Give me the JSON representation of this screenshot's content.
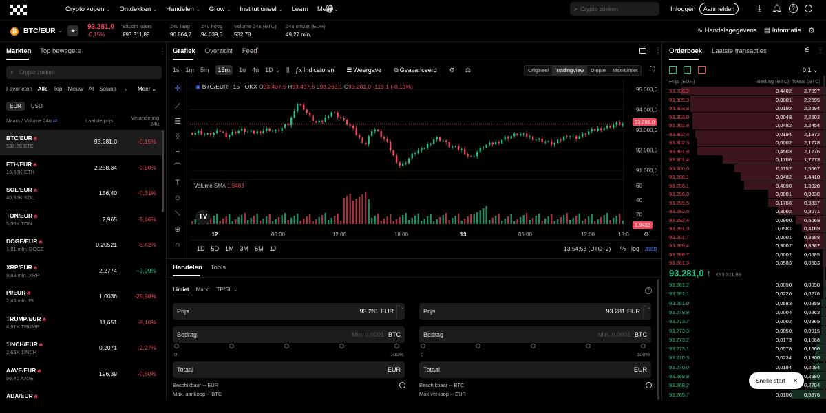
{
  "nav": {
    "items": [
      "Crypto kopen",
      "Ontdekken",
      "Handelen",
      "Grow",
      "Institutioneel",
      "Learn",
      "Meer"
    ],
    "search_placeholder": "Crypto zoeken",
    "login": "Inloggen",
    "signup": "Aanmelden"
  },
  "ticker": {
    "pair": "BTC/EUR",
    "last_price": "93.281,0",
    "change": "-0,15%",
    "stats": [
      {
        "label": "Bitcoin koers",
        "value": "€93.311,89"
      },
      {
        "label": "24u laag",
        "value": "90.864,7"
      },
      {
        "label": "24u hoog",
        "value": "94.039,8"
      },
      {
        "label": "Volume 24u (BTC)",
        "value": "532,78"
      },
      {
        "label": "24u omzet (EUR)",
        "value": "49,27 mln."
      }
    ],
    "trade_data": "Handelsgegevens",
    "info": "Informatie"
  },
  "markets": {
    "tabs": [
      "Markten",
      "Top bewegers"
    ],
    "search_placeholder": "Crypto zoeken",
    "filters": [
      "Favorieten",
      "Alle",
      "Top",
      "Nieuw",
      "AI",
      "Solana"
    ],
    "more": "Meer",
    "currencies": [
      "EUR",
      "USD"
    ],
    "col_name": "Naam / Volume 24u",
    "col_price": "Laatste prijs",
    "col_change": "Verandering 24u",
    "rows": [
      {
        "pair": "BTC/EUR",
        "vol": "532,78 BTC",
        "price": "93.281,0",
        "change": "-0,15%",
        "up": false
      },
      {
        "pair": "ETH/EUR",
        "vol": "16,66K ETH",
        "price": "2.258,34",
        "change": "-0,90%",
        "up": false
      },
      {
        "pair": "SOL/EUR",
        "vol": "40,35K SOL",
        "price": "156,40",
        "change": "-0,31%",
        "up": false
      },
      {
        "pair": "TON/EUR",
        "vol": "5,06K TON",
        "price": "2,965",
        "change": "-5,66%",
        "up": false
      },
      {
        "pair": "DOGE/EUR",
        "vol": "1,81 mln. DOGE",
        "price": "0,20521",
        "change": "-6,42%",
        "up": false
      },
      {
        "pair": "XRP/EUR",
        "vol": "9,83 mln. XRP",
        "price": "2,2774",
        "change": "+3,09%",
        "up": true
      },
      {
        "pair": "PI/EUR",
        "vol": "2,43 mln. PI",
        "price": "1,0036",
        "change": "-25,98%",
        "up": false
      },
      {
        "pair": "TRUMP/EUR",
        "vol": "4,91K TRUMP",
        "price": "11,651",
        "change": "-8,10%",
        "up": false
      },
      {
        "pair": "1INCH/EUR",
        "vol": "2,63K 1INCH",
        "price": "0,2071",
        "change": "-2,27%",
        "up": false
      },
      {
        "pair": "AAVE/EUR",
        "vol": "96,40 AAVE",
        "price": "196,39",
        "change": "-0,50%",
        "up": false
      },
      {
        "pair": "ADA/EUR",
        "vol": "",
        "price": "",
        "change": "",
        "up": false
      }
    ]
  },
  "chart": {
    "tabs": [
      "Grafiek",
      "Overzicht",
      "Feed"
    ],
    "timeframes": [
      "1s",
      "1m",
      "5m",
      "15m",
      "1u",
      "4u",
      "1D"
    ],
    "active_tf": "15m",
    "tools": [
      "Indicatoren",
      "Weergave",
      "Geavanceerd"
    ],
    "views": [
      "Origineel",
      "TradingView",
      "Diepte",
      "Marktlimiet"
    ],
    "active_view": "TradingView",
    "legend_pair": "BTC/EUR · 15 · OKX",
    "ohlc": {
      "O": "93.407,5",
      "H": "93.407,5",
      "L": "93.263,1",
      "C": "93.281,0",
      "chg": "-119,1 (-0,13%)"
    },
    "volume_label": "Volume",
    "sma_label": "SMA",
    "sma_value": "1,9483",
    "price_tag": "93.281,0",
    "vol_tag": "1,9483",
    "ranges": [
      "1D",
      "5D",
      "1M",
      "3M",
      "6M",
      "1J"
    ],
    "clock": "13:54:53 (UTC+2)",
    "scale_opts": [
      "%",
      "log",
      "auto"
    ]
  },
  "chart_data": {
    "type": "line",
    "title": "",
    "x_ticks": [
      "12",
      "06:00",
      "12:00",
      "18:00",
      "13",
      "06:00",
      "12:00",
      "18:0"
    ],
    "y_ticks": [
      "95.000,0",
      "94.000,0",
      "93.000,0",
      "92.000,0",
      "91.000,0"
    ],
    "volume_ticks": [
      "60",
      "40",
      "20"
    ],
    "ylim": [
      90800,
      95200
    ],
    "series": [
      {
        "name": "BTC/EUR",
        "values": [
          92850,
          92900,
          92750,
          92800,
          92950,
          92700,
          92880,
          93000,
          92900,
          92850,
          92950,
          93050,
          92900,
          93100,
          93300,
          94300,
          94100,
          93600,
          93300,
          93500,
          93900,
          93700,
          93400,
          93100,
          92600,
          92300,
          93100,
          92800,
          92400,
          91700,
          91200,
          91500,
          91900,
          92000,
          92300,
          92600,
          92500,
          92200,
          92100,
          92000,
          91600,
          91900,
          92200,
          92300,
          92400,
          92600,
          92700,
          92800,
          92700,
          92600,
          92500,
          92400,
          92300,
          92500,
          92750,
          92600,
          92700,
          92900,
          93000,
          93100,
          93150,
          93300,
          93281
        ]
      }
    ]
  },
  "trade": {
    "tabs": [
      "Handelen",
      "Tools"
    ],
    "order_types": [
      "Limiet",
      "Markt",
      "TP/SL"
    ],
    "buy": {
      "price_label": "Prijs",
      "price": "93.281",
      "price_unit": "EUR",
      "amount_label": "Bedrag",
      "amount_ph": "Min. 0,0001",
      "amount_unit": "BTC",
      "total_label": "Totaal",
      "total_unit": "EUR",
      "avail": "Beschikbaar -- EUR",
      "max": "Max. aankoop -- BTC",
      "pct0": "0",
      "pct100": "100%"
    },
    "sell": {
      "price_label": "Prijs",
      "price": "93.281",
      "price_unit": "EUR",
      "amount_label": "Bedrag",
      "amount_ph": "Min. 0,0001",
      "amount_unit": "BTC",
      "total_label": "Totaal",
      "total_unit": "EUR",
      "avail": "Beschikbaar -- BTC",
      "max": "Max verkoop -- EUR",
      "pct0": "0",
      "pct100": "100%"
    }
  },
  "orderbook": {
    "tabs": [
      "Orderboek",
      "Laatste transacties"
    ],
    "precision": "0,1",
    "col_price": "Prijs (EUR)",
    "col_amount": "Bedrag (BTC)",
    "col_total": "Totaal (BTC)",
    "asks": [
      [
        "93.306,2",
        "0,4402",
        "2,7097"
      ],
      [
        "93.305,3",
        "0,0001",
        "2,2695"
      ],
      [
        "93.303,8",
        "0,0192",
        "2,2694"
      ],
      [
        "93.303,0",
        "0,0048",
        "2,2502"
      ],
      [
        "93.302,8",
        "0,0482",
        "2,2454"
      ],
      [
        "93.302,4",
        "0,0194",
        "2,1972"
      ],
      [
        "93.302,3",
        "0,0002",
        "2,1778"
      ],
      [
        "93.301,8",
        "0,4503",
        "2,1776"
      ],
      [
        "93.301,4",
        "0,1706",
        "1,7273"
      ],
      [
        "93.300,0",
        "0,1157",
        "1,5567"
      ],
      [
        "93.298,1",
        "0,0482",
        "1,4410"
      ],
      [
        "93.296,1",
        "0,4090",
        "1,3928"
      ],
      [
        "93.296,0",
        "0,0001",
        "0,9838"
      ],
      [
        "93.295,5",
        "0,1766",
        "0,9837"
      ],
      [
        "93.292,5",
        "0,3002",
        "0,8071"
      ],
      [
        "93.292,4",
        "0,0900",
        "0,5069"
      ],
      [
        "93.291,9",
        "0,0581",
        "0,4169"
      ],
      [
        "93.291,7",
        "0,0001",
        "0,3588"
      ],
      [
        "93.289,4",
        "0,3002",
        "0,3587"
      ],
      [
        "93.288,7",
        "0,0002",
        "0,0585"
      ],
      [
        "93.281,3",
        "0,0583",
        "0,0583"
      ]
    ],
    "ask_depth": [
      0.9,
      0.84,
      0.84,
      0.83,
      0.83,
      0.81,
      0.8,
      0.8,
      0.64,
      0.57,
      0.53,
      0.51,
      0.36,
      0.36,
      0.3,
      0.19,
      0.15,
      0.13,
      0.13,
      0.02,
      0.02
    ],
    "mid_price": "93.281,0",
    "mid_eur": "€93.311,89",
    "bids": [
      [
        "93.281,2",
        "0,0050",
        "0,0050"
      ],
      [
        "93.281,1",
        "0,0226",
        "0,0276"
      ],
      [
        "93.281,0",
        "0,0583",
        "0,0859"
      ],
      [
        "93.279,8",
        "0,0004",
        "0,0863"
      ],
      [
        "93.273,7",
        "0,0002",
        "0,0865"
      ],
      [
        "93.273,3",
        "0,0050",
        "0,0915"
      ],
      [
        "93.273,2",
        "0,0173",
        "0,1088"
      ],
      [
        "93.273,1",
        "0,0578",
        "0,1666"
      ],
      [
        "93.270,3",
        "0,0234",
        "0,1900"
      ],
      [
        "93.270,0",
        "0,0194",
        "0,2094"
      ],
      [
        "93.269,8",
        "0,0586",
        "0,2680"
      ],
      [
        "93.268,2",
        "0,0024",
        "0,2704"
      ],
      [
        "93.265,7",
        "0,0106",
        "0,5876"
      ]
    ],
    "bid_depth": [
      0.005,
      0.01,
      0.03,
      0.03,
      0.03,
      0.03,
      0.04,
      0.06,
      0.07,
      0.08,
      0.1,
      0.1,
      0.22
    ],
    "snelle_start": "Snelle start"
  }
}
